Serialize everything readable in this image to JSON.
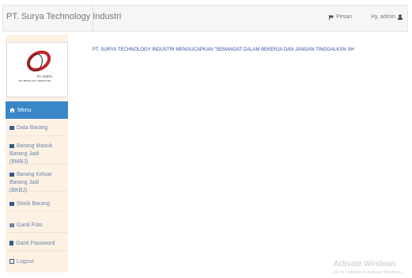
{
  "header": {
    "brand": "PT. Surya Technology Industri",
    "pesan_label": "Pesan",
    "user_label": "Hy, admin"
  },
  "logo": {
    "line1": "PT. SURYA",
    "line2": "TECHNOLOGY INDUSTRI"
  },
  "sidebar": {
    "menu_label": "Menu",
    "items": [
      {
        "label": "Data Barang",
        "icon": "table-icon"
      },
      {
        "label": "Barang Masuk Barang Jadi (BMBJ)",
        "icon": "table-icon"
      },
      {
        "label": "Barang Keluar Barang Jadi (BKBJ)",
        "icon": "table-icon"
      },
      {
        "label": "Stock Barang",
        "icon": "table-icon"
      },
      {
        "label": "Ganti Foto",
        "icon": "image-icon"
      },
      {
        "label": "Ganti Password",
        "icon": "lock-icon"
      },
      {
        "label": "Logout",
        "icon": "logout-icon"
      }
    ]
  },
  "main": {
    "marquee_text": "PT. SURYA TECHNOLOGY INDUSTRI MENGUCAPKAN \"SEMANGAT DALAM BEKERJA DAN JANGAN TINGGALKAN SH"
  },
  "watermark": {
    "title": "Activate Windows",
    "subtitle": "Go to Settings to activate Windows."
  },
  "colors": {
    "menu_active": "#3a87c8",
    "sidebar_bg": "#fdf1e4",
    "marquee_text": "#2f55a6"
  }
}
